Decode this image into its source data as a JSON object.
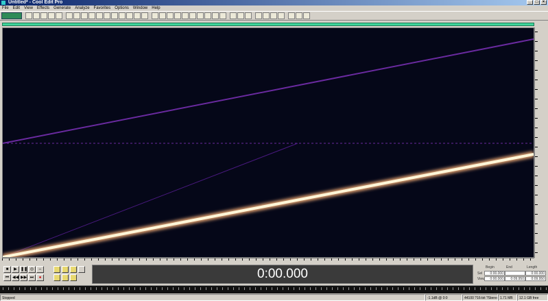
{
  "window": {
    "title": "Untitled* - Cool Edit Pro",
    "minimize": "_",
    "maximize": "□",
    "close": "×"
  },
  "menu": [
    "File",
    "Edit",
    "View",
    "Effects",
    "Generate",
    "Analyze",
    "Favorites",
    "Options",
    "Window",
    "Help"
  ],
  "time_display": "0:00.000",
  "selection_panel": {
    "headers": [
      "Begin",
      "End",
      "Length"
    ],
    "rows": [
      {
        "label": "Sel",
        "begin": "0:00.000",
        "end": "",
        "length": "0:00.000"
      },
      {
        "label": "View",
        "begin": "0:00.000",
        "end": "0:09.950",
        "length": "0:09.950"
      }
    ]
  },
  "status": {
    "state": "Stopped",
    "level": "-1.1dB @ 0:0",
    "format": "44100 ?16-bit ?Stereo",
    "size": "1.71 MB",
    "free": "12.1 GB free"
  },
  "transport": {
    "buttons_row1": [
      "■",
      "▶",
      "❚❚",
      "◎",
      "⇔"
    ],
    "buttons_row2": [
      "⏮",
      "◀◀",
      "▶▶",
      "⏭",
      "●"
    ]
  },
  "colors": {
    "waveform_bg": "#050718",
    "sweep_bright": "#fff6d8",
    "sweep_glow": "#e0a070",
    "harmonic": "#6a2aa0",
    "overview": "#3ed49a"
  }
}
